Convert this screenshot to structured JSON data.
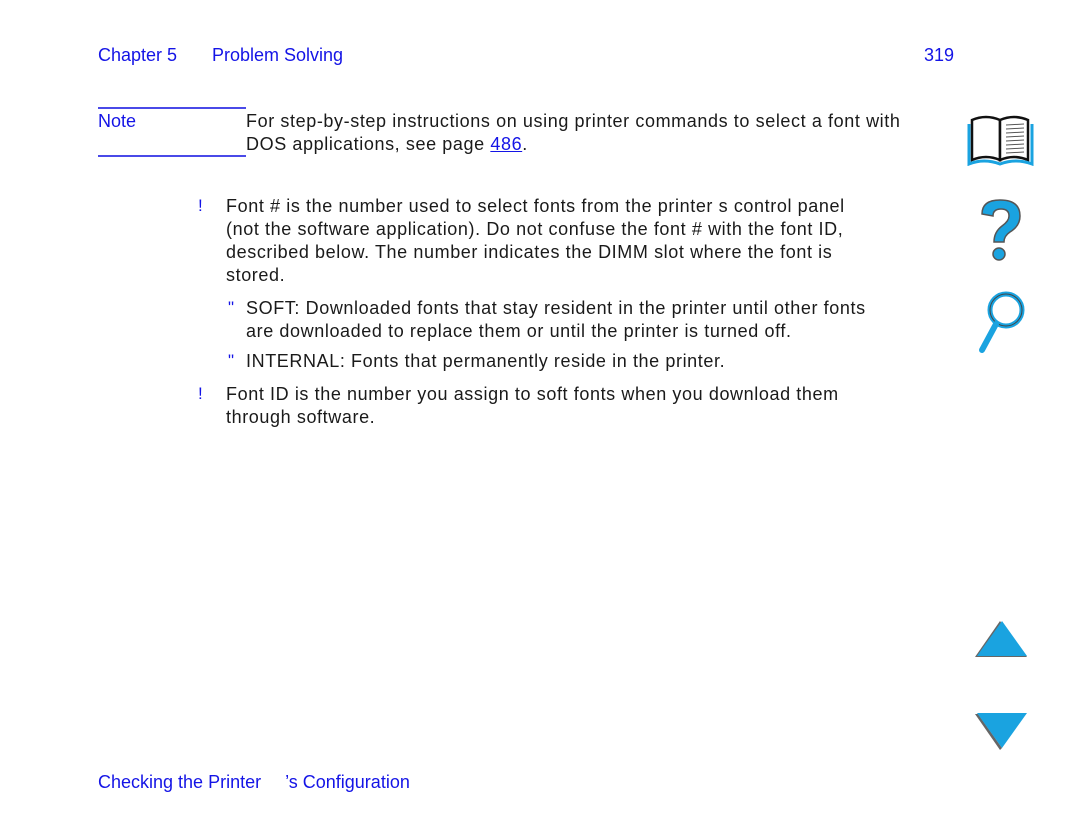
{
  "header": {
    "chapter": "Chapter 5",
    "section": "Problem Solving",
    "page_number": "319"
  },
  "note": {
    "label": "Note",
    "text_before": "For step-by-step instructions on using printer commands to select a font with DOS applications, see page ",
    "link_text": "486",
    "text_after": "."
  },
  "list": {
    "item1_marker": "!",
    "item1_line1": "Font # is the number used to select fonts from the printer s control panel",
    "item1_line2": "(not the software application). Do not confuse the font # with the font ID,",
    "item1_line3": "described below. The number indicates the DIMM slot where the font is",
    "item1_line4": "stored.",
    "sub1_marker": "\"",
    "sub1_line1": "SOFT: Downloaded fonts that stay resident in the printer until other fonts",
    "sub1_line2": "are downloaded to replace them or until the printer is turned off.",
    "sub2_marker": "\"",
    "sub2_line1": "INTERNAL: Fonts that permanently reside in the printer.",
    "item2_marker": "!",
    "item2_line1": "Font ID is the number you assign to soft fonts when you download them",
    "item2_line2": "through software."
  },
  "footer": {
    "part1": "Checking the Printer",
    "part2": "’s Configuration"
  },
  "nav_icons": {
    "contents": "book-icon",
    "help": "question-mark-icon",
    "search": "magnifier-icon",
    "prev": "up-arrow-icon",
    "next": "down-arrow-icon"
  },
  "colors": {
    "accent_text": "#1414e6",
    "icon_fill": "#1aa3e0"
  }
}
